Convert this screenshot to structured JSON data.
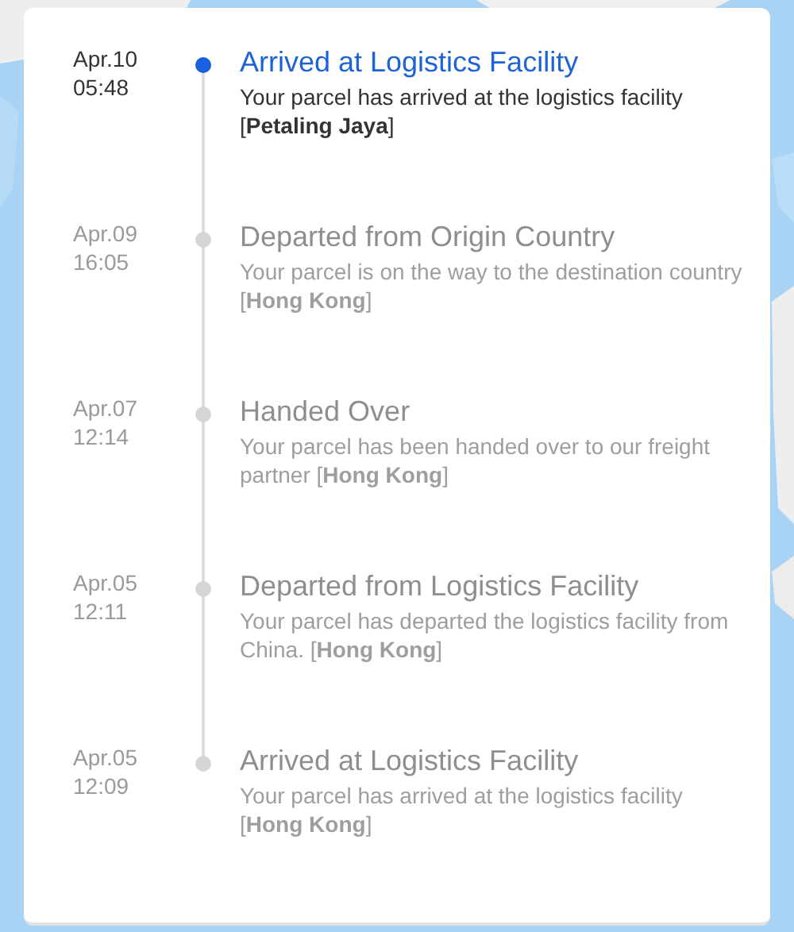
{
  "events": [
    {
      "date": "Apr.10",
      "time": "05:48",
      "title": "Arrived at Logistics Facility",
      "description": "Your parcel has arrived at the logistics facility [**Petaling Jaya**]",
      "current": true
    },
    {
      "date": "Apr.09",
      "time": "16:05",
      "title": "Departed from Origin Country",
      "description": "Your parcel is on the way to the destination country [**Hong Kong**]",
      "current": false
    },
    {
      "date": "Apr.07",
      "time": "12:14",
      "title": "Handed Over",
      "description": "Your parcel has been handed over to our freight partner [**Hong Kong**]",
      "current": false
    },
    {
      "date": "Apr.05",
      "time": "12:11",
      "title": "Departed from Logistics Facility",
      "description": "Your parcel has departed the logistics facility from China. [**Hong Kong**]",
      "current": false
    },
    {
      "date": "Apr.05",
      "time": "12:09",
      "title": "Arrived at Logistics Facility",
      "description": "Your parcel has arrived at the logistics facility [**Hong Kong**]",
      "current": false
    }
  ]
}
